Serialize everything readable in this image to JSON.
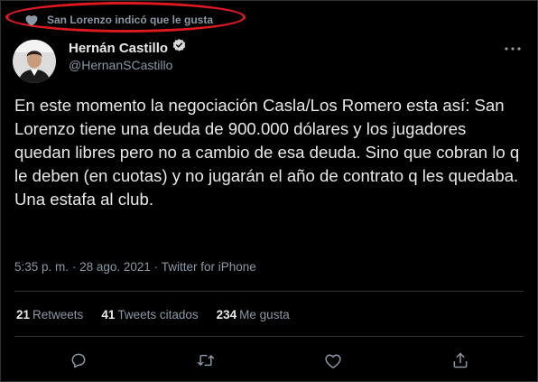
{
  "context": {
    "text": "San Lorenzo indicó que le gusta",
    "icon": "heart-icon"
  },
  "author": {
    "name": "Hernán Castillo",
    "handle": "@HernanSCastillo",
    "verified": true
  },
  "tweet": {
    "text": "En este momento la negociación Casla/Los Romero esta así: San Lorenzo tiene una deuda de 900.000 dólares y los jugadores quedan libres pero no a cambio de esa deuda. Sino que cobran lo q le deben (en cuotas) y no jugarán el año de contrato q les quedaba. Una estafa al club.",
    "time": "5:35 p. m.",
    "date": "28 ago. 2021",
    "source": "Twitter for iPhone",
    "meta_separator": "·"
  },
  "stats": {
    "retweets_count": "21",
    "retweets_label": "Retweets",
    "quotes_count": "41",
    "quotes_label": "Tweets citados",
    "likes_count": "234",
    "likes_label": "Me gusta"
  },
  "colors": {
    "background": "#000000",
    "text_primary": "#e7e9ea",
    "text_secondary": "#8b98a5",
    "border": "#2f3336",
    "highlight": "#e0181f"
  }
}
